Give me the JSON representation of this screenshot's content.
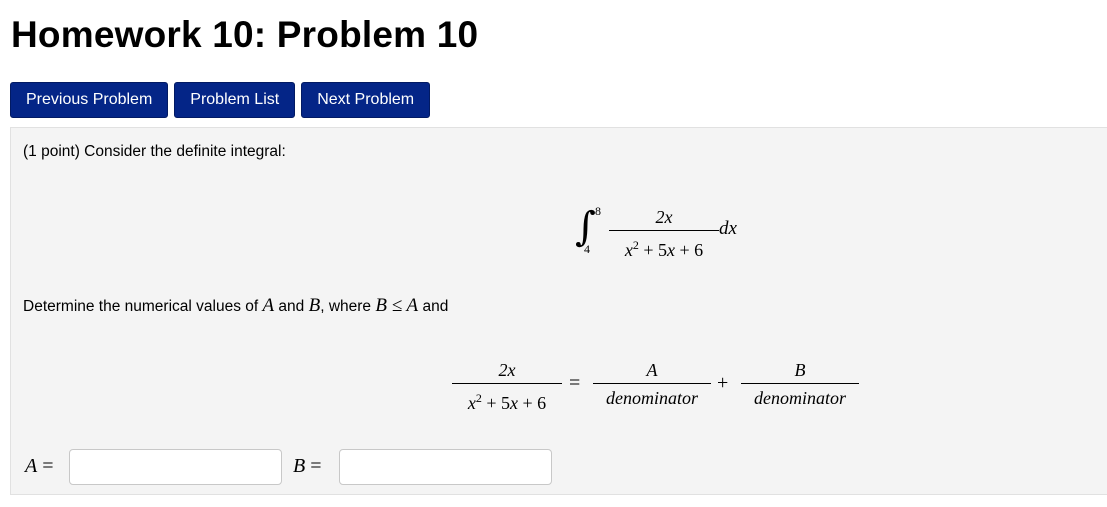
{
  "page_title": "Homework 10: Problem 10",
  "nav": {
    "previous_label": "Previous Problem",
    "list_label": "Problem List",
    "next_label": "Next Problem",
    "button_color": "#042587"
  },
  "problem": {
    "intro": "(1 point) Consider the definite integral:",
    "integral": {
      "upper": "8",
      "lower": "4",
      "numerator": "2x",
      "denominator": "x² + 5x + 6",
      "differential": "dx"
    },
    "instruction_prefix": "Determine the numerical values of ",
    "var_a": "A",
    "and_word": " and ",
    "var_b": "B",
    "where_text": ", where ",
    "condition": "B ≤ A",
    "instruction_suffix": " and",
    "decomposition": {
      "left_numerator": "2x",
      "left_denominator": "x² + 5x + 6",
      "equals": "=",
      "term1_numerator": "A",
      "term1_denominator": "denominator",
      "plus": "+",
      "term2_numerator": "B",
      "term2_denominator": "denominator"
    }
  },
  "answers": {
    "a_label": "A =",
    "a_value": "",
    "b_label": "B =",
    "b_value": ""
  }
}
